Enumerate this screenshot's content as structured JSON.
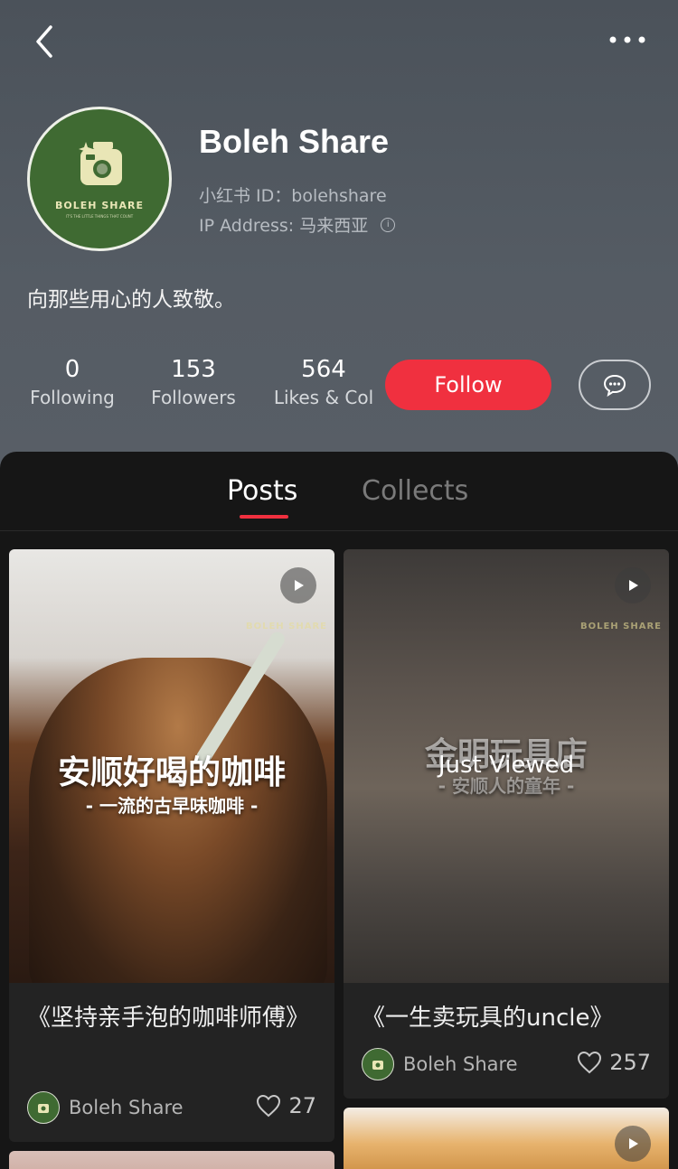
{
  "nav": {
    "back_icon": "chevron-left-icon",
    "more_icon": "more-dots-icon"
  },
  "profile": {
    "avatar_brand": "BOLEH SHARE",
    "avatar_tagline": "IT'S THE LITTLE THINGS THAT COUNT",
    "name": "Boleh Share",
    "id_line": "小红书 ID：bolehshare",
    "ip_line": "IP Address: 马来西亚",
    "bio": "向那些用心的人致敬。"
  },
  "stats": {
    "following": {
      "value": "0",
      "label": "Following"
    },
    "followers": {
      "value": "153",
      "label": "Followers"
    },
    "likes": {
      "value": "564",
      "label": "Likes & Col"
    }
  },
  "actions": {
    "follow_label": "Follow",
    "message_icon": "message-bubble-icon"
  },
  "tabs": {
    "posts": "Posts",
    "collects": "Collects"
  },
  "posts": [
    {
      "overlay_title": "安顺好喝的咖啡",
      "overlay_sub": "- 一流的古早味咖啡 -",
      "watermark": "BOLEH SHARE",
      "title": "《坚持亲手泡的咖啡师傅》",
      "author": "Boleh Share",
      "likes": "27"
    },
    {
      "overlay_title": "金明玩具店",
      "overlay_sub": "- 安顺人的童年 -",
      "badge": "Just Viewed",
      "watermark": "BOLEH SHARE",
      "title": "《一生卖玩具的uncle》",
      "author": "Boleh Share",
      "likes": "257"
    }
  ],
  "colors": {
    "accent": "#f0303f",
    "header_bg": "#525961",
    "content_bg": "#161616",
    "card_bg": "#232323"
  }
}
